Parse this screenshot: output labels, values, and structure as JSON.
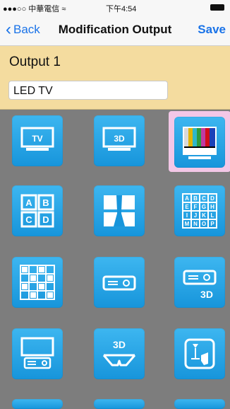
{
  "status": {
    "carrier": "●●●○○ 中華電信 ≈",
    "time": "下午4:54"
  },
  "nav": {
    "back_label": "Back",
    "title": "Modification Output",
    "save_label": "Save"
  },
  "output": {
    "label": "Output 1",
    "name_value": "LED TV"
  },
  "tiles": {
    "tv": "TV",
    "tv3d": "3D",
    "abcd": [
      "A",
      "B",
      "C",
      "D"
    ],
    "alpha16": [
      "A",
      "B",
      "C",
      "D",
      "E",
      "F",
      "G",
      "H",
      "I",
      "J",
      "K",
      "L",
      "M",
      "N",
      "O",
      "P"
    ],
    "proj3d": "3D",
    "glasses3d": "3D"
  }
}
